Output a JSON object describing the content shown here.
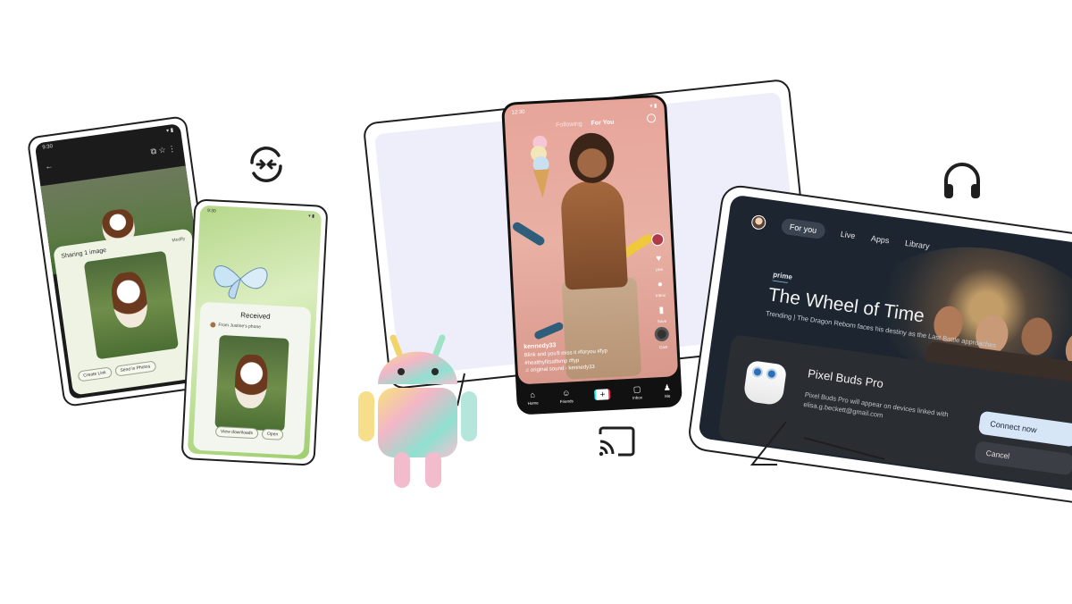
{
  "phone_share": {
    "title": "Sharing 1 image",
    "modify": "Modify",
    "actions": [
      "Create Link",
      "Send in Photos"
    ]
  },
  "phone_received": {
    "title": "Received",
    "from": "From Justine's phone",
    "actions": [
      "View downloads",
      "Open"
    ]
  },
  "video_app": {
    "time": "12:30",
    "tabs": [
      "Following",
      "For You"
    ],
    "handle": "kennedy33",
    "caption": "Blink and you'll miss it #foryou #fyp #healthyfitsalfsmp #fyp",
    "sound": "original sound - kennedy33",
    "side_labels": [
      "Inbox",
      "Like",
      "Save",
      "Cast"
    ],
    "nav": [
      "Home",
      "Friends",
      "Inbox",
      "Me"
    ]
  },
  "tv": {
    "nav": [
      "For you",
      "Live",
      "Apps",
      "Library"
    ],
    "brand": "prime",
    "show_title": "The Wheel of Time",
    "trending": "Trending | The Dragon Reborn faces his destiny as the Last Battle approaches",
    "device_title": "Pixel Buds Pro",
    "device_body": "Pixel Buds Pro will appear on devices linked with elisa.g.beckett@gmail.com",
    "connect_label": "Connect now",
    "cancel_label": "Cancel"
  },
  "icons": [
    "sync-icon",
    "cast-icon",
    "headphones-icon",
    "android-robot"
  ],
  "colors": {
    "outline": "#1f1f1f",
    "tablet_fill": "#eeeefb",
    "tv_dark": "#1d2630",
    "connect_btn": "#d7e6f7"
  }
}
